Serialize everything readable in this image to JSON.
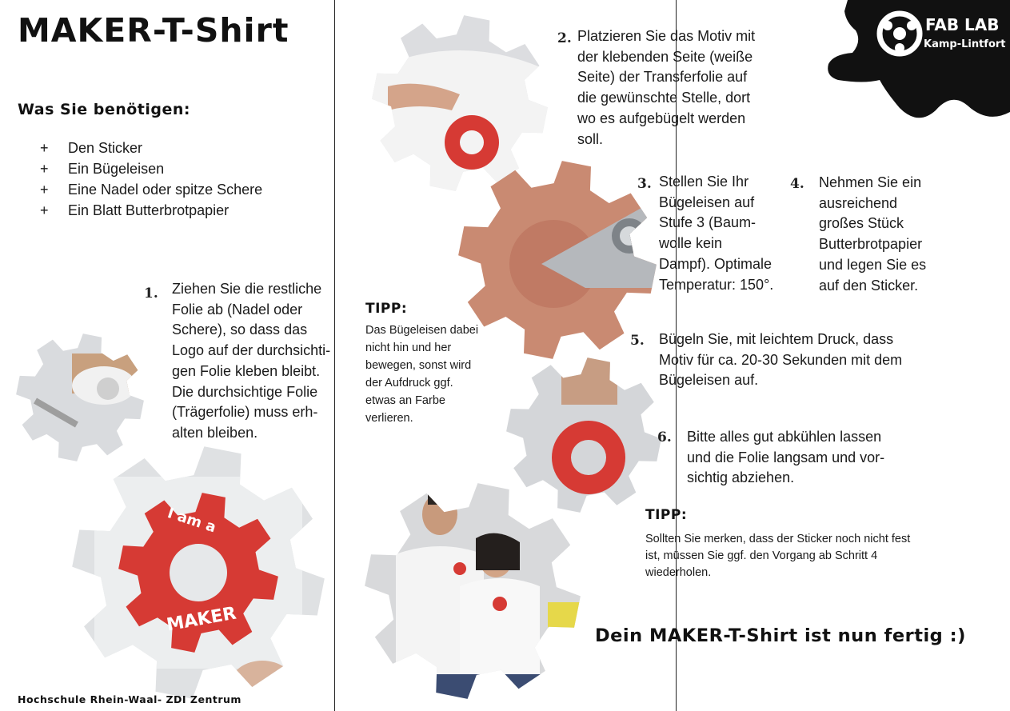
{
  "title": "MAKER-T-Shirt",
  "needs": {
    "heading": "Was Sie benötigen:",
    "bullet": "+",
    "items": [
      "Den Sticker",
      "Ein Bügeleisen",
      "Eine Nadel oder spitze Schere",
      "Ein Blatt Butterbrotpapier"
    ]
  },
  "steps": [
    {
      "num": "1.",
      "lines": [
        "Ziehen Sie die restliche",
        "Folie ab (Nadel oder",
        "Schere), so dass das",
        "Logo auf der durchsichti-",
        "gen Folie kleben bleibt.",
        "Die durchsichtige Folie",
        "(Trägerfolie) muss erh-",
        "alten bleiben."
      ]
    },
    {
      "num": "2.",
      "lines": [
        "Platzieren Sie das Motiv mit",
        "der klebenden Seite (weiße",
        "Seite) der Transferfolie auf",
        "die gewünschte Stelle, dort",
        "wo es aufgebügelt werden",
        "soll."
      ]
    },
    {
      "num": "3.",
      "lines": [
        "Stellen Sie Ihr",
        "Bügeleisen auf",
        "Stufe 3 (Baum-",
        "wolle kein",
        "Dampf). Optimale",
        "Temperatur: 150°."
      ]
    },
    {
      "num": "4.",
      "lines": [
        "Nehmen Sie ein",
        "ausreichend",
        "großes Stück",
        "Butterbrotpapier",
        "und legen Sie es",
        "auf den Sticker."
      ]
    },
    {
      "num": "5.",
      "lines": [
        "Bügeln Sie, mit leichtem Druck, dass",
        "Motiv für ca. 20-30 Sekunden mit dem",
        "Bügeleisen auf."
      ]
    },
    {
      "num": "6.",
      "lines": [
        "Bitte alles gut abkühlen lassen",
        "und die Folie langsam und vor-",
        "sichtig abziehen."
      ]
    }
  ],
  "tips": [
    {
      "heading": "TIPP:",
      "lines": [
        "Das Bügeleisen dabei",
        "nicht hin und her",
        "bewegen, sonst wird",
        "der Aufdruck ggf.",
        "etwas an Farbe",
        "verlieren."
      ]
    },
    {
      "heading": "TIPP:",
      "lines": [
        "Sollten Sie merken, dass der Sticker noch nicht fest",
        "ist, müssen Sie ggf. den Vorgang ab Schritt 4",
        "wiederholen."
      ]
    }
  ],
  "final": "Dein MAKER-T-Shirt ist nun fertig :)",
  "footer": "Hochschule Rhein-Waal- ZDI Zentrum",
  "logo": {
    "line1": "FAB LAB",
    "line2": "Kamp-Lintfort"
  },
  "sticker": {
    "line1": "I am a",
    "line2": "MAKER"
  },
  "colors": {
    "sticker_red": "#d63a34",
    "ink": "#111111",
    "photo_grey": "#d9dbde",
    "paper": "#c98a72"
  },
  "icons": [
    "fablab-logo-icon",
    "gear-photo-icon"
  ]
}
